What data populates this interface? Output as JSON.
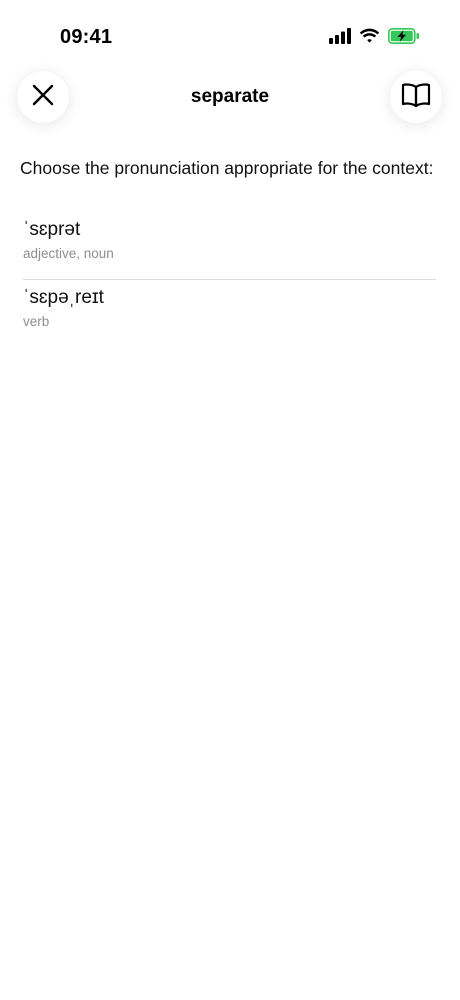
{
  "status_bar": {
    "time": "09:41",
    "icons": [
      "cellular-signal-icon",
      "wifi-icon",
      "battery-charging-icon"
    ],
    "battery_color": "#34c759"
  },
  "header": {
    "title": "separate",
    "close_icon": "close-icon",
    "dictionary_icon": "book-icon"
  },
  "prompt": "Choose the pronunciation appropriate for the context:",
  "options": [
    {
      "ipa": "ˈsɛprət",
      "pos": "adjective, noun"
    },
    {
      "ipa": "ˈsɛpəˌreɪt",
      "pos": "verb"
    }
  ]
}
